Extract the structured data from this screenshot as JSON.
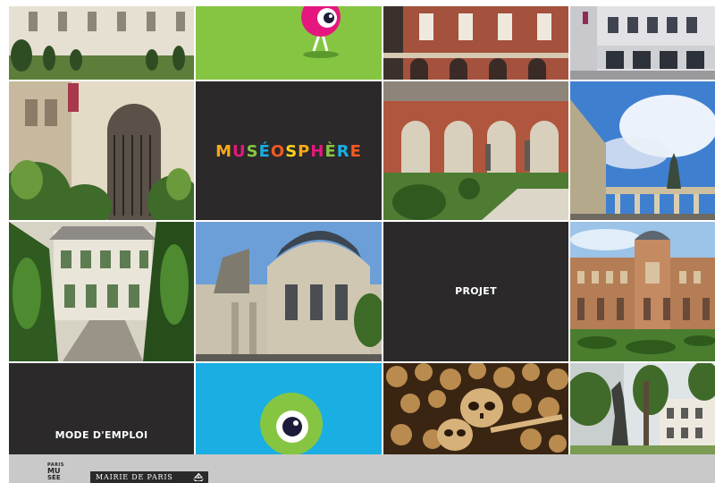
{
  "tiles": {
    "museosphere": {
      "title": "MUSÉOSPHÈRE"
    },
    "projet": {
      "label": "PROJET"
    },
    "mode_emploi": {
      "label": "MODE D'EMPLOI"
    }
  },
  "footer": {
    "logo_top": "PARIS",
    "logo_line1": "MU",
    "logo_line2": "SÉE",
    "mairie_label": "MAIRIE DE PARIS"
  },
  "colors": {
    "dark_tile": "#2b2929",
    "green_tile": "#86c542",
    "blue_tile": "#1aaee3",
    "footer_bar": "#c9c9c9"
  },
  "icons": [
    "pink-eye-character-icon",
    "green-eye-icon",
    "paris-musees-logo-icon",
    "mairie-ship-icon"
  ]
}
